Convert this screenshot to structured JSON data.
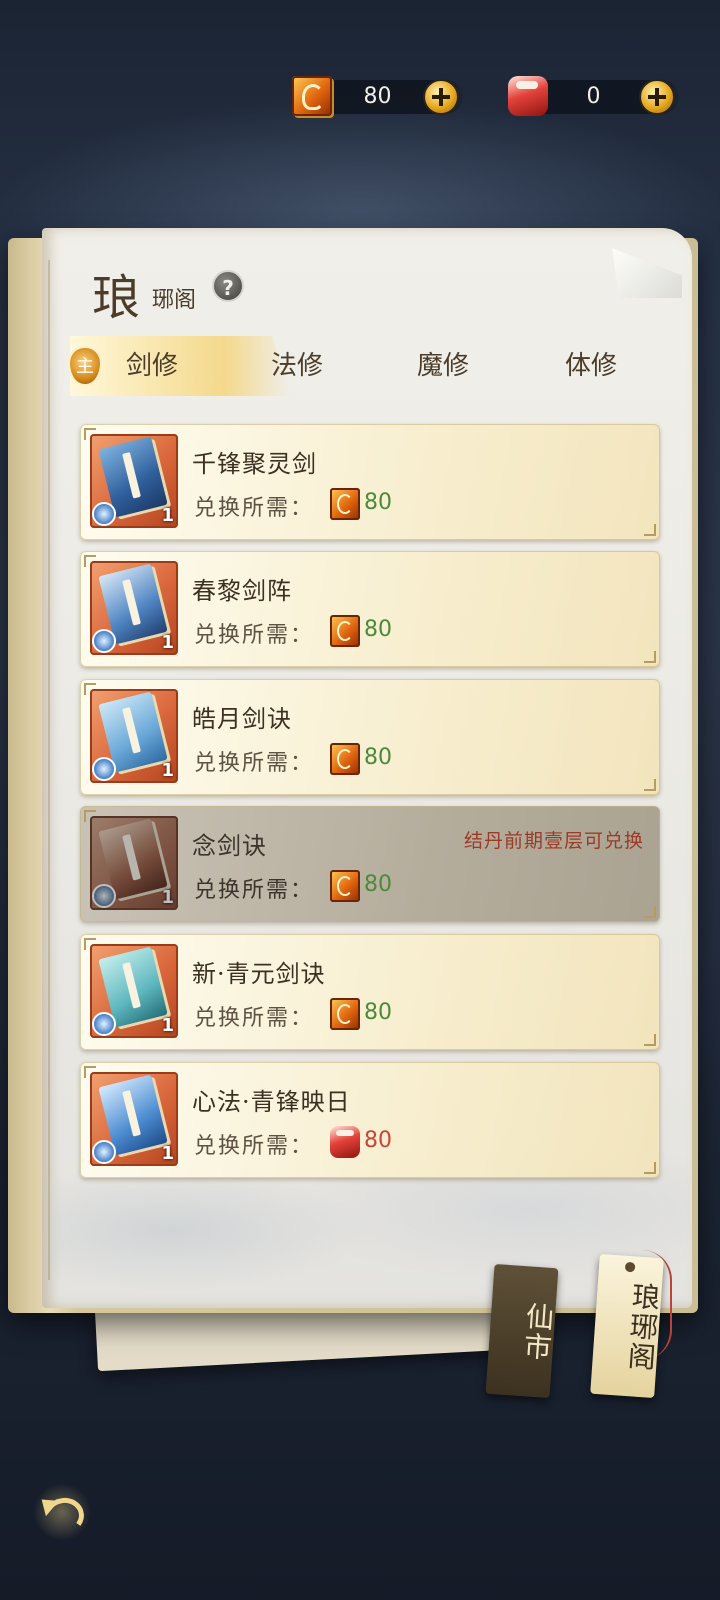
{
  "currencies": [
    {
      "icon": "skill-book-currency-icon",
      "value": "80"
    },
    {
      "icon": "scroll-currency-icon",
      "value": "0"
    }
  ],
  "header": {
    "title_big": "琅",
    "title_small": "琊阁",
    "help_glyph": "?"
  },
  "tabs": {
    "main_badge": "主",
    "items": [
      "剑修",
      "法修",
      "魔修",
      "体修"
    ],
    "active_index": 0
  },
  "items": [
    {
      "name": "千锋聚灵剑",
      "cost_label": "兑换所需：",
      "cost_icon": "skill-book-currency-icon",
      "cost": "80",
      "qty": "1",
      "locked": false,
      "requirement": ""
    },
    {
      "name": "春黎剑阵",
      "cost_label": "兑换所需：",
      "cost_icon": "skill-book-currency-icon",
      "cost": "80",
      "qty": "1",
      "locked": false,
      "requirement": ""
    },
    {
      "name": "皓月剑诀",
      "cost_label": "兑换所需：",
      "cost_icon": "skill-book-currency-icon",
      "cost": "80",
      "qty": "1",
      "locked": false,
      "requirement": ""
    },
    {
      "name": "念剑诀",
      "cost_label": "兑换所需：",
      "cost_icon": "skill-book-currency-icon",
      "cost": "80",
      "qty": "1",
      "locked": true,
      "requirement": "结丹前期壹层可兑换"
    },
    {
      "name": "新·青元剑诀",
      "cost_label": "兑换所需：",
      "cost_icon": "skill-book-currency-icon",
      "cost": "80",
      "qty": "1",
      "locked": false,
      "requirement": ""
    },
    {
      "name": "心法·青锋映日",
      "cost_label": "兑换所需：",
      "cost_icon": "scroll-currency-icon",
      "cost": "80",
      "qty": "1",
      "locked": false,
      "requirement": ""
    }
  ],
  "side_tags": {
    "xianshi": "仙市",
    "langya": "琅琊阁"
  },
  "colors": {
    "cost_green": "#4c8a3a",
    "cost_red": "#c9453a",
    "requirement_red": "#9b3a26",
    "active_tab_gold": "#f4d98c"
  }
}
